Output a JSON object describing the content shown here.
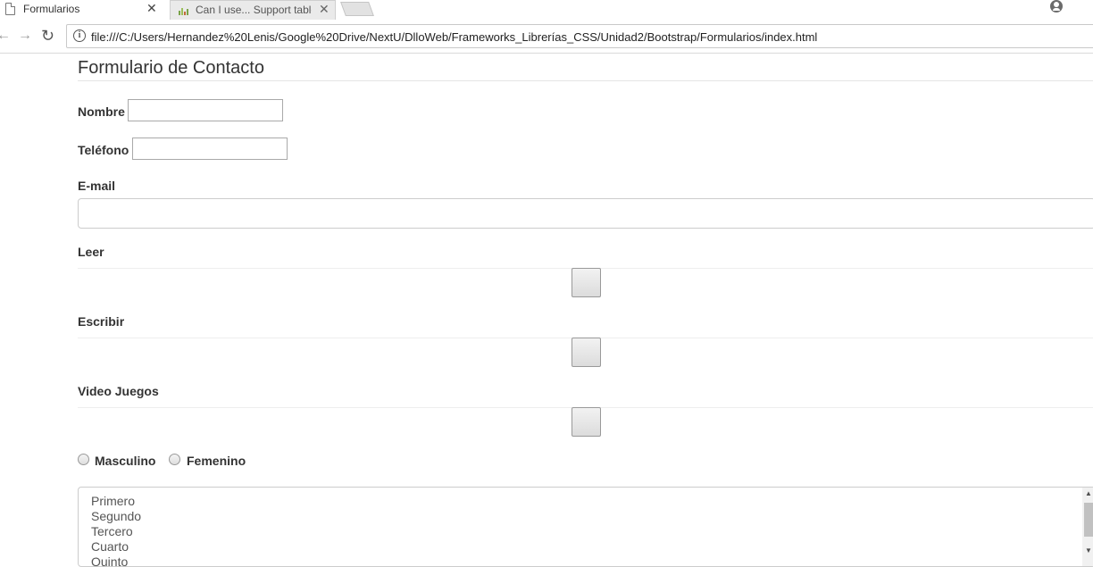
{
  "browser": {
    "tabs": [
      {
        "title": "Formularios",
        "close": "✕"
      },
      {
        "title": "Can I use... Support table",
        "close": "✕"
      }
    ],
    "nav": {
      "back": "←",
      "forward": "→",
      "reload": "↻"
    },
    "address_bar": {
      "info": "i",
      "url": "file:///C:/Users/Hernandez%20Lenis/Google%20Drive/NextU/DlloWeb/Frameworks_Librerías_CSS/Unidad2/Bootstrap/Formularios/index.html"
    }
  },
  "form": {
    "title": "Formulario de Contacto",
    "nombre_label": "Nombre",
    "telefono_label": "Teléfono",
    "email_label": "E-mail",
    "ranges": [
      {
        "label": "Leer"
      },
      {
        "label": "Escribir"
      },
      {
        "label": "Video Juegos"
      }
    ],
    "gender": {
      "option1": "Masculino",
      "option2": "Femenino"
    },
    "list_options": [
      "Primero",
      "Segundo",
      "Tercero",
      "Cuarto",
      "Quinto"
    ]
  },
  "colors": {
    "accent_border": "#cccccc",
    "text": "#333333"
  }
}
